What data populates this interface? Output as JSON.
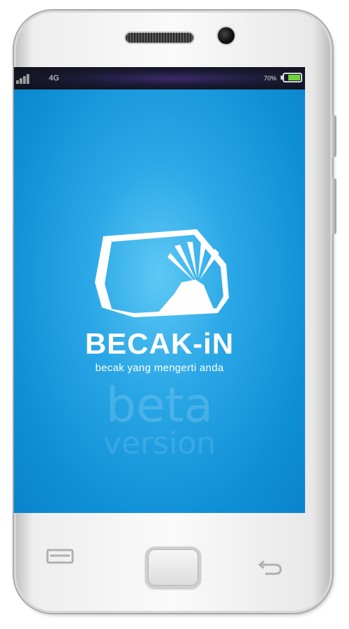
{
  "status_bar": {
    "network": "4G",
    "battery_percent": "70%",
    "battery_level": 0.7,
    "signal_icon": "signal-bars-icon"
  },
  "splash": {
    "app_name": "BECAK-iN",
    "tagline": "becak yang mengerti anda",
    "watermark_line1": "beta",
    "watermark_line2": "version",
    "logo_icon": "becak-logo-icon",
    "background_color": "#1a9be0"
  },
  "hardware": {
    "menu_icon": "menu-icon",
    "home_icon": "home-button",
    "back_icon": "back-arrow-icon"
  }
}
